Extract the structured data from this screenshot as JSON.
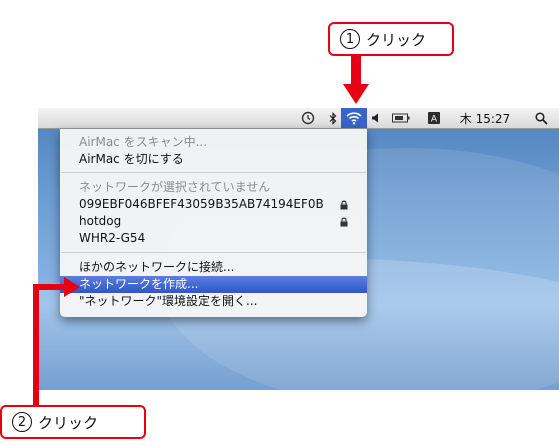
{
  "callouts": {
    "top": {
      "number": "1",
      "label": "クリック"
    },
    "bottom": {
      "number": "2",
      "label": "クリック"
    }
  },
  "menubar": {
    "clock": "木 15:27",
    "icons": [
      "time-machine-icon",
      "bluetooth-icon",
      "wifi-icon",
      "volume-icon",
      "battery-icon",
      "input-menu-icon",
      "spotlight-icon"
    ]
  },
  "airport_menu": {
    "status": "AirMac をスキャン中...",
    "toggle": "AirMac を切にする",
    "no_network": "ネットワークが選択されていません",
    "networks": [
      {
        "name": "099EBF046BFEF43059B35AB74194EF0B",
        "locked": true
      },
      {
        "name": "hotdog",
        "locked": true
      },
      {
        "name": "WHR2-G54",
        "locked": false
      }
    ],
    "join_other": "ほかのネットワークに接続...",
    "create_network": "ネットワークを作成...",
    "open_prefs": "\"ネットワーク\"環境設定を開く..."
  },
  "colors": {
    "callout_border": "#e60012",
    "highlight": "#3a5fd0"
  }
}
